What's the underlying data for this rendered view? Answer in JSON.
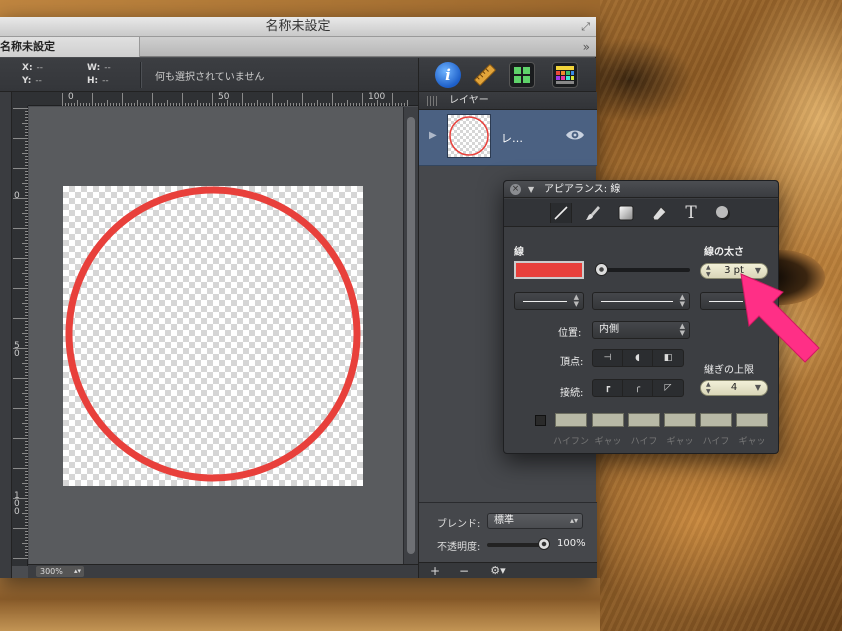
{
  "window": {
    "title": "名称未設定",
    "tab": "名称未設定",
    "tab_more": "»"
  },
  "infobar": {
    "x_label": "X:",
    "x_value": "--",
    "y_label": "Y:",
    "y_value": "--",
    "w_label": "W:",
    "w_value": "--",
    "h_label": "H:",
    "h_value": "--",
    "selection": "何も選択されていません"
  },
  "toolbar": {
    "info_glyph": "i"
  },
  "ruler": {
    "top_labels": [
      "0",
      "50",
      "100"
    ],
    "left_labels": [
      "0",
      "5\n0",
      "1\n0\n0"
    ]
  },
  "status": {
    "zoom": "300%"
  },
  "layers": {
    "title": "レイヤー",
    "layer_name": "レ…",
    "blend_label": "ブレンド:",
    "blend_value": "標準",
    "opacity_label": "不透明度:",
    "opacity_value": "100%",
    "add": "+",
    "remove": "−",
    "action": "⚙▾"
  },
  "appearance": {
    "title": "アピアランス: 線",
    "stroke_label": "線",
    "stroke_width_label": "線の太さ",
    "stroke_width_value": "3 pt",
    "stroke_color": "#e8403b",
    "position_label": "位置:",
    "position_value": "内側",
    "cap_label": "頂点:",
    "join_label": "接続:",
    "miter_label": "継ぎの上限",
    "miter_value": "4",
    "dash_labels": [
      "ハイフン",
      "ギャッ",
      "ハイフ",
      "ギャッ",
      "ハイフ",
      "ギャッ"
    ]
  },
  "canvas": {
    "circle_color": "#e8403b"
  }
}
